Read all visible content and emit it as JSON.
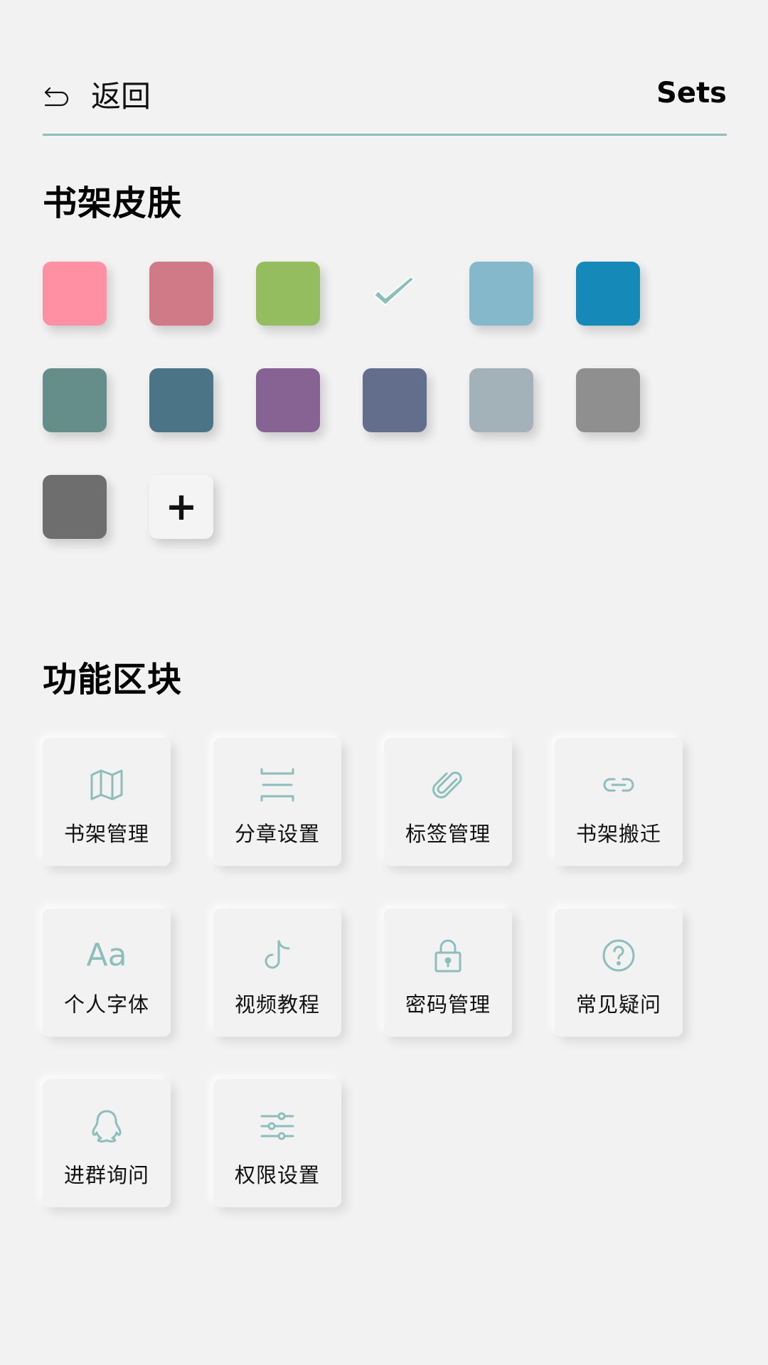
{
  "header": {
    "back_label": "返回",
    "title": "Sets"
  },
  "skin": {
    "title": "书架皮肤",
    "swatches": [
      {
        "color": "#ff8fa3",
        "selected": false
      },
      {
        "color": "#d07a87",
        "selected": false
      },
      {
        "color": "#93bd5e",
        "selected": false
      },
      {
        "color": "#8cbfbb",
        "selected": true
      },
      {
        "color": "#86b8cb",
        "selected": false
      },
      {
        "color": "#1589b8",
        "selected": false
      },
      {
        "color": "#658d8a",
        "selected": false
      },
      {
        "color": "#4b7587",
        "selected": false
      },
      {
        "color": "#876393",
        "selected": false
      },
      {
        "color": "#626e8c",
        "selected": false
      },
      {
        "color": "#a3b2b8",
        "selected": false
      },
      {
        "color": "#8f8f8f",
        "selected": false
      },
      {
        "color": "#6e6e6e",
        "selected": false
      }
    ],
    "add_label": "+"
  },
  "functions": {
    "title": "功能区块",
    "accent": "#8cbfbb",
    "tiles": [
      {
        "label": "书架管理",
        "icon": "map-icon"
      },
      {
        "label": "分章设置",
        "icon": "split-icon"
      },
      {
        "label": "标签管理",
        "icon": "paperclip-icon"
      },
      {
        "label": "书架搬迁",
        "icon": "link-icon"
      },
      {
        "label": "个人字体",
        "icon": "font-icon",
        "icon_text": "Aa"
      },
      {
        "label": "视频教程",
        "icon": "tiktok-icon"
      },
      {
        "label": "密码管理",
        "icon": "lock-icon"
      },
      {
        "label": "常见疑问",
        "icon": "question-icon"
      },
      {
        "label": "进群询问",
        "icon": "qq-icon"
      },
      {
        "label": "权限设置",
        "icon": "sliders-icon"
      }
    ]
  }
}
